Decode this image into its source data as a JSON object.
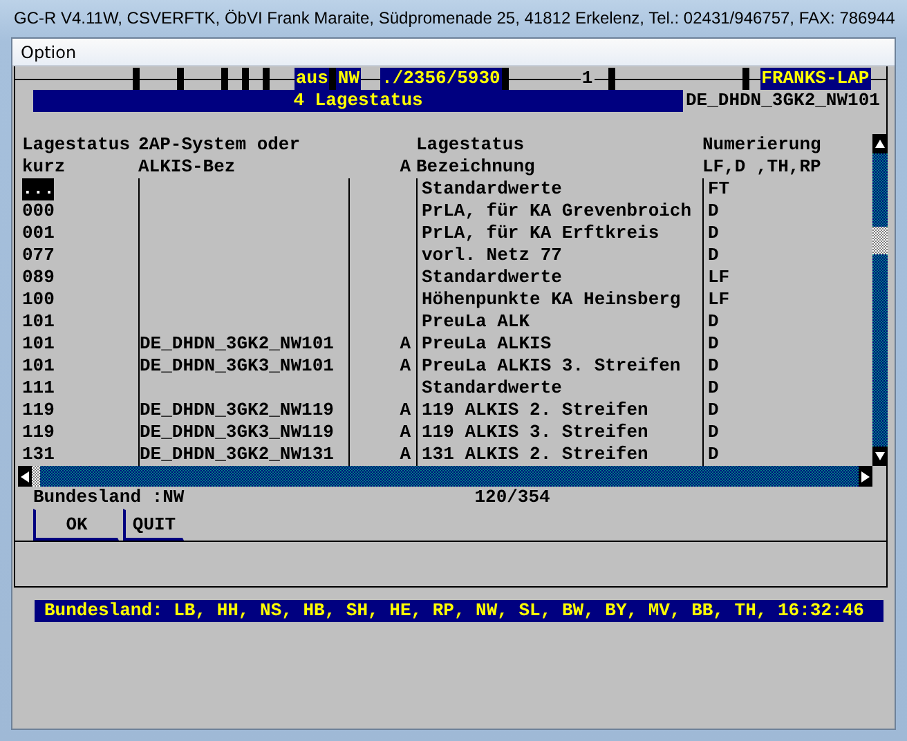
{
  "window": {
    "title": "GC-R V4.11W, CSVERFTK, ÖbVI Frank Maraite, Südpromenade 25, 41812 Erkelenz, Tel.: 02431/946757, FAX: 786944"
  },
  "menu": [
    "Option"
  ],
  "top_line": [
    "aus",
    "NW",
    "./2356/5930",
    "1",
    "FRANKS-LAP"
  ],
  "panel": {
    "title": "4 Lagestatus",
    "current": "DE_DHDN_3GK2_NW101"
  },
  "table": {
    "columns": [
      {
        "line1": "Lagestatus",
        "line2": "kurz"
      },
      {
        "line1": "2AP-System oder",
        "line2": "ALKIS-Bez"
      },
      {
        "line2": "A"
      },
      {
        "line1": "Lagestatus",
        "line2": "Bezeichnung"
      },
      {
        "line1": "Numerierung",
        "line2": "LF,D ,TH,RP"
      }
    ],
    "rows": [
      {
        "kurz": "...",
        "bez": "Standardwerte",
        "num": "FT",
        "selected": true
      },
      {
        "kurz": "000",
        "bez": "PrLA, für KA Grevenbroich",
        "num": "D",
        "selected": false
      },
      {
        "kurz": "001",
        "bez": "PrLA, für KA Erftkreis",
        "num": "D",
        "selected": false
      },
      {
        "kurz": "077",
        "bez": "vorl. Netz 77",
        "num": "D",
        "selected": false
      },
      {
        "kurz": "089",
        "bez": "Standardwerte",
        "num": "LF",
        "selected": false
      },
      {
        "kurz": "100",
        "bez": "Höhenpunkte KA Heinsberg",
        "num": "LF",
        "selected": false
      },
      {
        "kurz": "101",
        "bez": "PreuLa ALK",
        "num": "D",
        "selected": false
      },
      {
        "kurz": "101",
        "alkis": "DE_DHDN_3GK2_NW101",
        "a": "A",
        "bez": "PreuLa ALKIS",
        "num": "D",
        "selected": false
      },
      {
        "kurz": "101",
        "alkis": "DE_DHDN_3GK3_NW101",
        "a": "A",
        "bez": "PreuLa ALKIS 3. Streifen",
        "num": "D",
        "selected": false
      },
      {
        "kurz": "111",
        "bez": "Standardwerte",
        "num": "D",
        "selected": false
      },
      {
        "kurz": "119",
        "alkis": "DE_DHDN_3GK2_NW119",
        "a": "A",
        "bez": "119 ALKIS 2. Streifen",
        "num": "D",
        "selected": false
      },
      {
        "kurz": "119",
        "alkis": "DE_DHDN_3GK3_NW119",
        "a": "A",
        "bez": "119 ALKIS 3. Streifen",
        "num": "D",
        "selected": false
      },
      {
        "kurz": "131",
        "alkis": "DE_DHDN_3GK2_NW131",
        "a": "A",
        "bez": "131 ALKIS 2. Streifen",
        "num": "D",
        "selected": false
      }
    ]
  },
  "footer": {
    "bundesland": "Bundesland :NW",
    "count": "120/354"
  },
  "buttons": [
    "OK",
    "QUIT"
  ],
  "status_bar": "Bundesland: LB, HH, NS, HB, SH, HE, RP, NW, SL, BW, BY, MV, BB, TH, 16:32:46"
}
